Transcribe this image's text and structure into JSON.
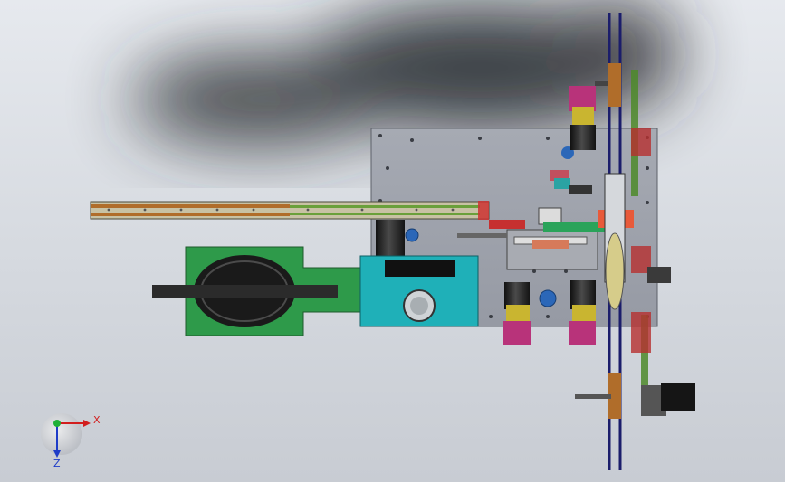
{
  "viewport": {
    "background_top": "#e6e9ee",
    "background_bottom": "#c8ccd3",
    "shadow_color": "#1f2226"
  },
  "model": {
    "base_plate_color": "#9fa3ad",
    "rail_color": "#b06d2a",
    "rail_accent": "#4e8a2a",
    "pad_color": "#2e9a4a",
    "block_color": "#1fb0b8",
    "belt_color": "#1b1d6b",
    "cylinder_color": "#2a2a2a",
    "cylinder_collar": "#c9b530",
    "valve_color": "#b8337a",
    "bolt_color": "#2b4fa8"
  },
  "triad": {
    "x_label": "X",
    "z_label": "Z",
    "x_color": "#d21e1e",
    "z_color": "#1e3cc8",
    "origin_color": "#1fb037"
  }
}
